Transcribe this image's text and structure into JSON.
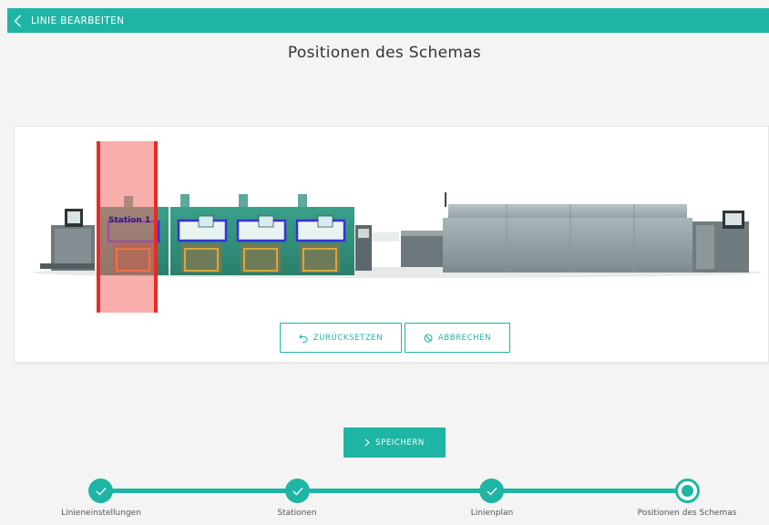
{
  "topbar": {
    "title": "LINIE BEARBEITEN",
    "back_icon": "chevron-left-icon",
    "color": "#1fb5a4"
  },
  "page": {
    "title": "Positionen des Schemas"
  },
  "schema": {
    "station_label": "Station 1",
    "selection_color": "#f0554f"
  },
  "actions": {
    "reset_label": "ZURÜCKSETZEN",
    "reset_icon": "undo-icon",
    "cancel_label": "ABBRECHEN",
    "cancel_icon": "prohibit-icon",
    "save_label": "SPEICHERN",
    "save_icon": "chevron-right-icon"
  },
  "stepper": {
    "steps": [
      {
        "label": "Linieneinstellungen",
        "state": "done"
      },
      {
        "label": "Stationen",
        "state": "done"
      },
      {
        "label": "Linienplan",
        "state": "done"
      },
      {
        "label": "Positionen des Schemas",
        "state": "current"
      }
    ]
  }
}
